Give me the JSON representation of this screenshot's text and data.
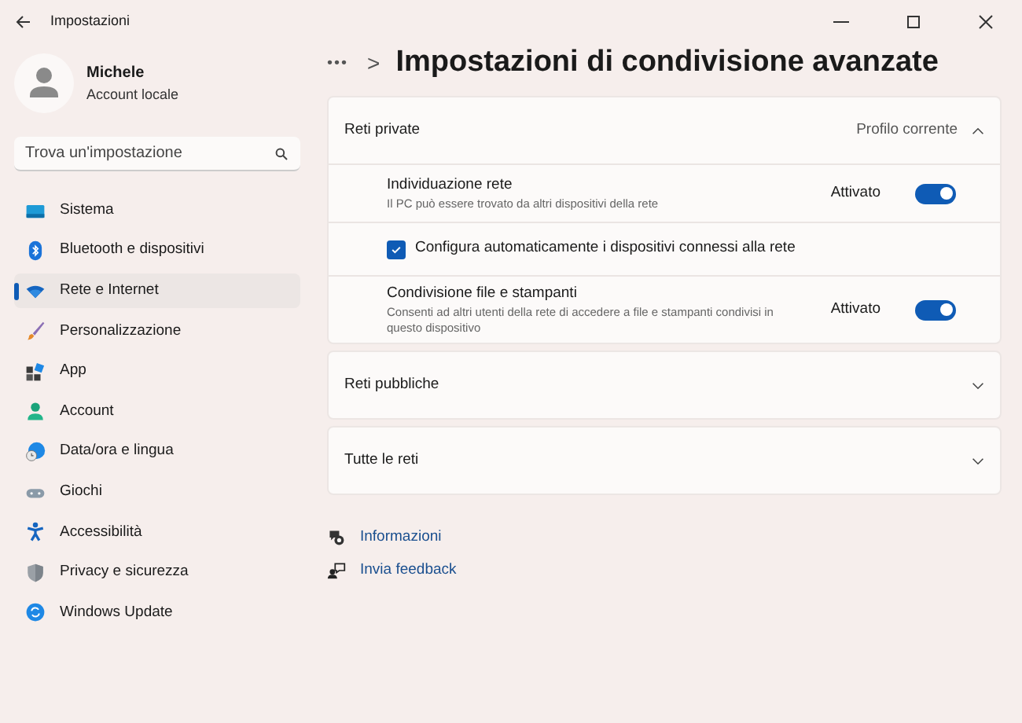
{
  "window": {
    "title": "Impostazioni"
  },
  "user": {
    "name": "Michele",
    "account": "Account locale"
  },
  "search": {
    "placeholder": "Trova un'impostazione"
  },
  "sidebar": {
    "items": [
      {
        "label": "Sistema",
        "selected": false
      },
      {
        "label": "Bluetooth e dispositivi",
        "selected": false
      },
      {
        "label": "Rete e Internet",
        "selected": true
      },
      {
        "label": "Personalizzazione",
        "selected": false
      },
      {
        "label": "App",
        "selected": false
      },
      {
        "label": "Account",
        "selected": false
      },
      {
        "label": "Data/ora e lingua",
        "selected": false
      },
      {
        "label": "Giochi",
        "selected": false
      },
      {
        "label": "Accessibilità",
        "selected": false
      },
      {
        "label": "Privacy e sicurezza",
        "selected": false
      },
      {
        "label": "Windows Update",
        "selected": false
      }
    ]
  },
  "breadcrumb": {
    "more": "•••",
    "separator": ">",
    "title": "Impostazioni di condivisione avanzate"
  },
  "sections": [
    {
      "title": "Reti private",
      "note": "Profilo corrente",
      "expanded": true,
      "rows": [
        {
          "kind": "toggle",
          "title": "Individuazione rete",
          "description": "Il PC può essere trovato da altri dispositivi della rete",
          "state_label": "Attivato",
          "on": true
        },
        {
          "kind": "checkbox",
          "title": "Configura automaticamente i dispositivi connessi alla rete",
          "checked": true
        },
        {
          "kind": "toggle",
          "title": "Condivisione file e stampanti",
          "description": "Consenti ad altri utenti della rete di accedere a file e stampanti condivisi in questo dispositivo",
          "state_label": "Attivato",
          "on": true
        }
      ]
    },
    {
      "title": "Reti pubbliche",
      "expanded": false
    },
    {
      "title": "Tutte le reti",
      "expanded": false
    }
  ],
  "links": [
    "Informazioni",
    "Invia feedback"
  ]
}
